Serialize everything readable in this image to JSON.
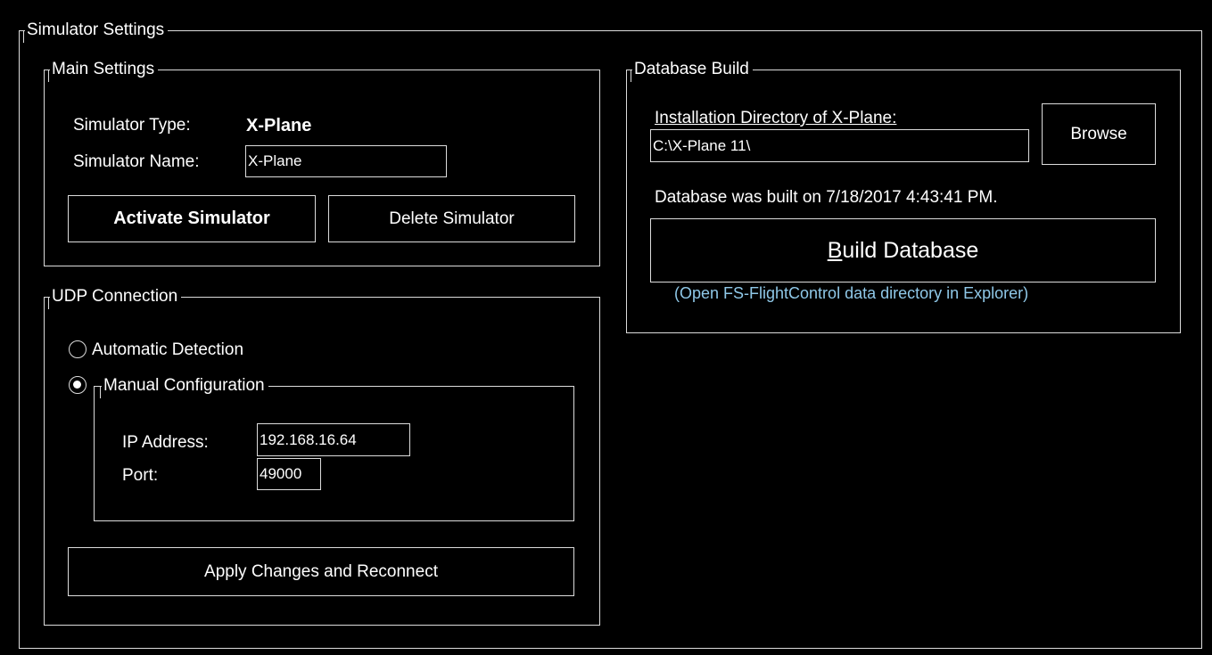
{
  "simulator_settings": {
    "title": "Simulator Settings",
    "main_settings": {
      "title": "Main Settings",
      "type_label": "Simulator Type:",
      "type_value": "X-Plane",
      "name_label": "Simulator Name:",
      "name_value": "X-Plane",
      "activate_button": "Activate Simulator",
      "delete_button": "Delete Simulator"
    },
    "udp_connection": {
      "title": "UDP Connection",
      "automatic_label": "Automatic Detection",
      "manual_label": "Manual Configuration",
      "selected": "manual",
      "ip_label": "IP Address:",
      "ip_value": "192.168.16.64",
      "port_label": "Port:",
      "port_value": "49000",
      "apply_button": "Apply Changes and Reconnect"
    },
    "database_build": {
      "title": "Database Build",
      "install_dir_label": "Installation Directory of X-Plane:",
      "install_dir_value": "C:\\X-Plane 11\\",
      "browse_button": "Browse",
      "built_status": "Database was built on 7/18/2017 4:43:41 PM.",
      "build_button_accel": "B",
      "build_button_rest": "uild Database",
      "open_dir_link": "(Open FS-FlightControl data directory in Explorer)"
    }
  }
}
